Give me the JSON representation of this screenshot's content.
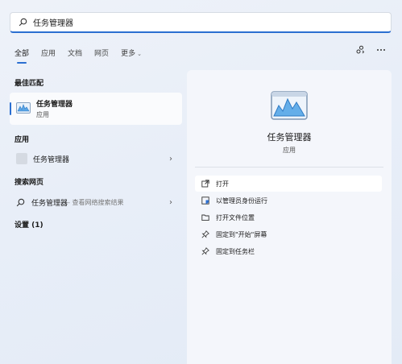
{
  "search": {
    "value": "任务管理器"
  },
  "tabs": [
    {
      "label": "全部",
      "active": true
    },
    {
      "label": "应用"
    },
    {
      "label": "文档"
    },
    {
      "label": "网页"
    },
    {
      "label": "更多"
    }
  ],
  "sections": {
    "best_match": "最佳匹配",
    "apps": "应用",
    "web": "搜索网页",
    "settings": "设置 (1)"
  },
  "best_match": {
    "name": "任务管理器",
    "type": "应用"
  },
  "app_result": {
    "name": "任务管理器"
  },
  "web_result": {
    "name": "任务管理器",
    "suffix": " - 查看网络搜索结果"
  },
  "detail": {
    "title": "任务管理器",
    "subtitle": "应用",
    "actions": [
      {
        "label": "打开",
        "icon": "open-external-icon"
      },
      {
        "label": "以管理员身份运行",
        "icon": "shield-admin-icon"
      },
      {
        "label": "打开文件位置",
        "icon": "folder-icon"
      },
      {
        "label": "固定到\"开始\"屏幕",
        "icon": "pin-icon"
      },
      {
        "label": "固定到任务栏",
        "icon": "pin-icon"
      }
    ]
  },
  "colors": {
    "accent": "#2b6fd1",
    "app_icon_graph": "#3a8fd8"
  }
}
